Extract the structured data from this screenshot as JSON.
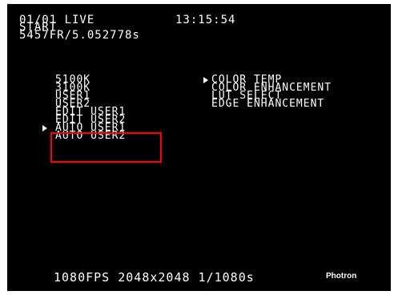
{
  "header": {
    "status": "01/01 LIVE",
    "clock": "13:15:54",
    "mode": "START",
    "frames": "5457FR/5.052778s"
  },
  "left_menu": {
    "items": [
      {
        "label": "5100K",
        "selected": false
      },
      {
        "label": "3100K",
        "selected": false
      },
      {
        "label": "USER1",
        "selected": false
      },
      {
        "label": "USER2",
        "selected": false
      },
      {
        "label": "EDIT USER1",
        "selected": false
      },
      {
        "label": "EDIT USER2",
        "selected": false
      },
      {
        "label": "AUTO USER1",
        "selected": true
      },
      {
        "label": "AUTO USER2",
        "selected": false
      }
    ]
  },
  "right_menu": {
    "items": [
      {
        "label": "COLOR TEMP",
        "selected": true
      },
      {
        "label": "COLOR ENHANCEMENT",
        "selected": false
      },
      {
        "label": "LUT SELECT",
        "selected": false
      },
      {
        "label": "EDGE ENHANCEMENT",
        "selected": false
      }
    ]
  },
  "footer": {
    "info": "1080FPS 2048x2048 1/1080s",
    "brand": "Photron"
  },
  "colors": {
    "background": "#000000",
    "text": "#ffffff",
    "highlight": "#ff0000"
  }
}
